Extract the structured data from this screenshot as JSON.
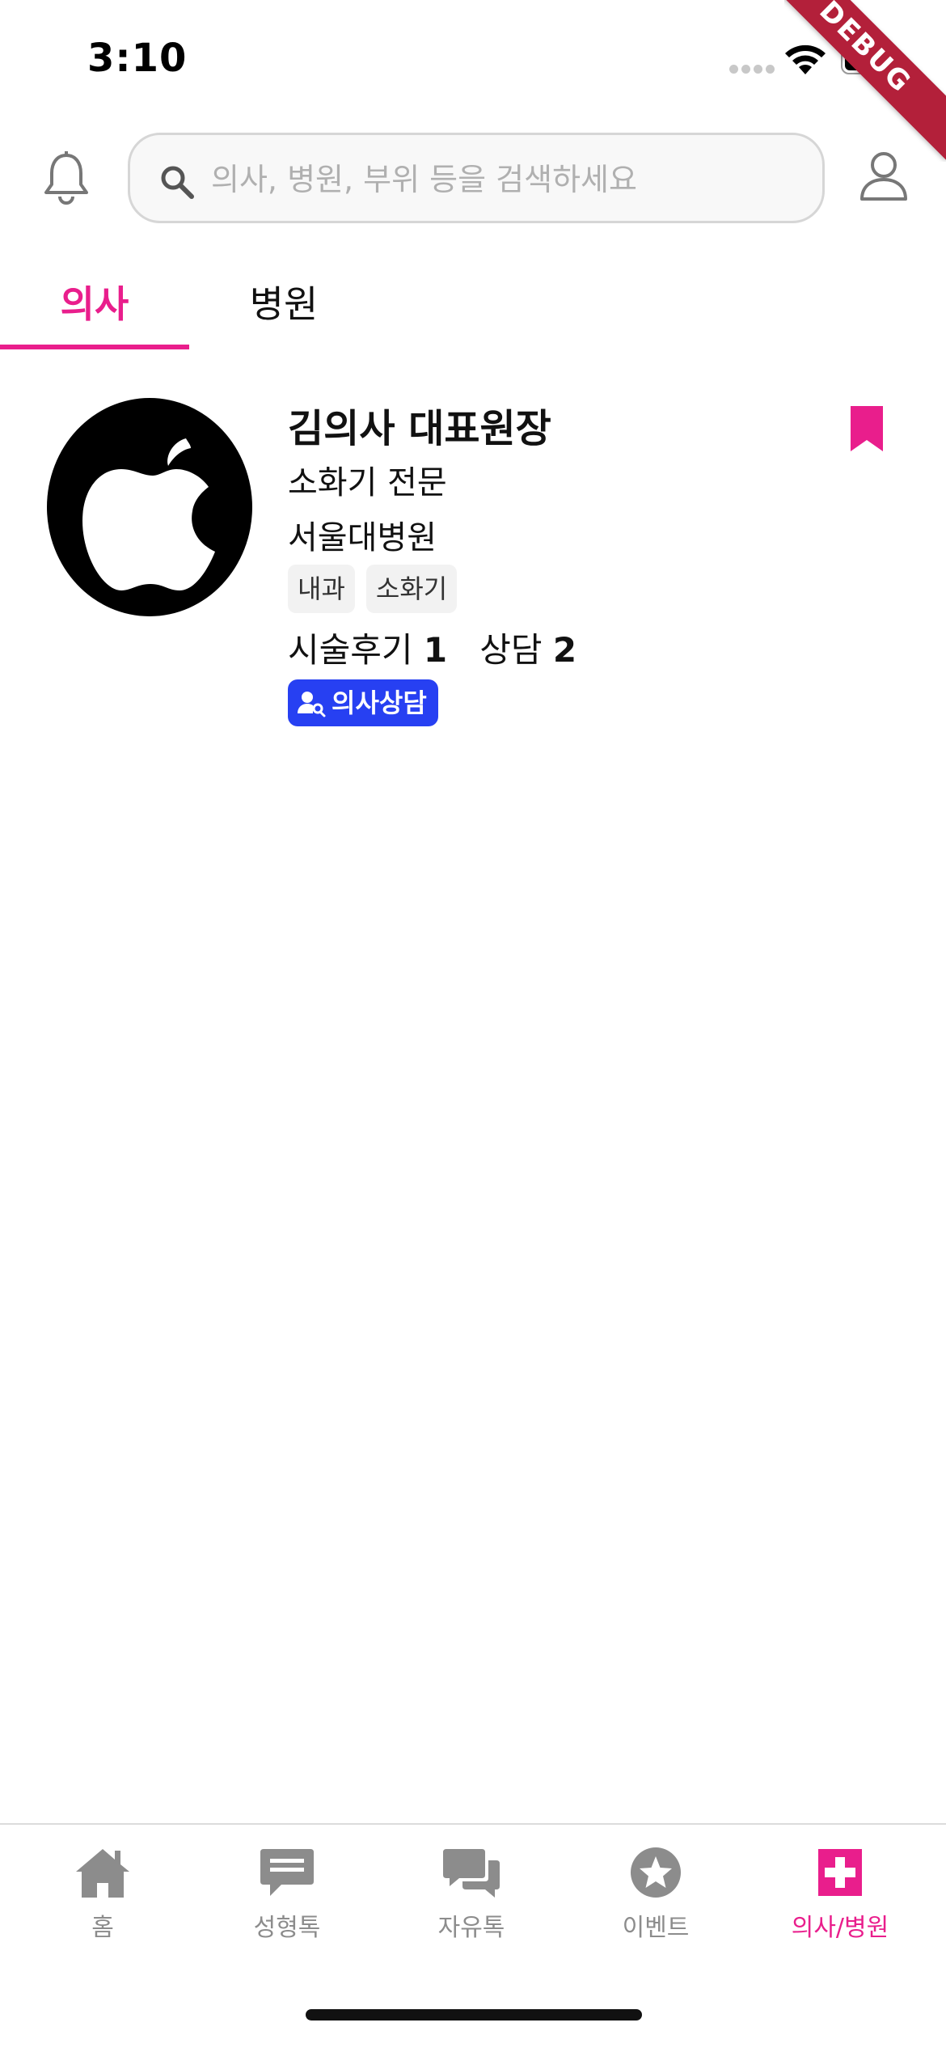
{
  "status_bar": {
    "time": "3:10",
    "debug_label": "DEBUG"
  },
  "header": {
    "search_placeholder": "의사, 병원, 부위 등을 검색하세요"
  },
  "tabs": [
    {
      "label": "의사",
      "active": true
    },
    {
      "label": "병원",
      "active": false
    }
  ],
  "doctor": {
    "name": "김의사 대표원장",
    "specialty": "소화기 전문",
    "hospital": "서울대병원",
    "tags": [
      "내과",
      "소화기"
    ],
    "review_label": "시술후기",
    "review_count": "1",
    "consult_label": "상담",
    "consult_count": "2",
    "badge_label": "의사상담",
    "bookmarked": true
  },
  "bottom_nav": [
    {
      "label": "홈",
      "icon": "home-icon",
      "active": false
    },
    {
      "label": "성형톡",
      "icon": "chat-bubble-icon",
      "active": false
    },
    {
      "label": "자유톡",
      "icon": "chat-bubbles-icon",
      "active": false
    },
    {
      "label": "이벤트",
      "icon": "star-icon",
      "active": false
    },
    {
      "label": "의사/병원",
      "icon": "medical-cross-icon",
      "active": true
    }
  ],
  "colors": {
    "accent": "#e91e8c",
    "badge": "#2740f2",
    "inactive": "#8c8c8c"
  }
}
